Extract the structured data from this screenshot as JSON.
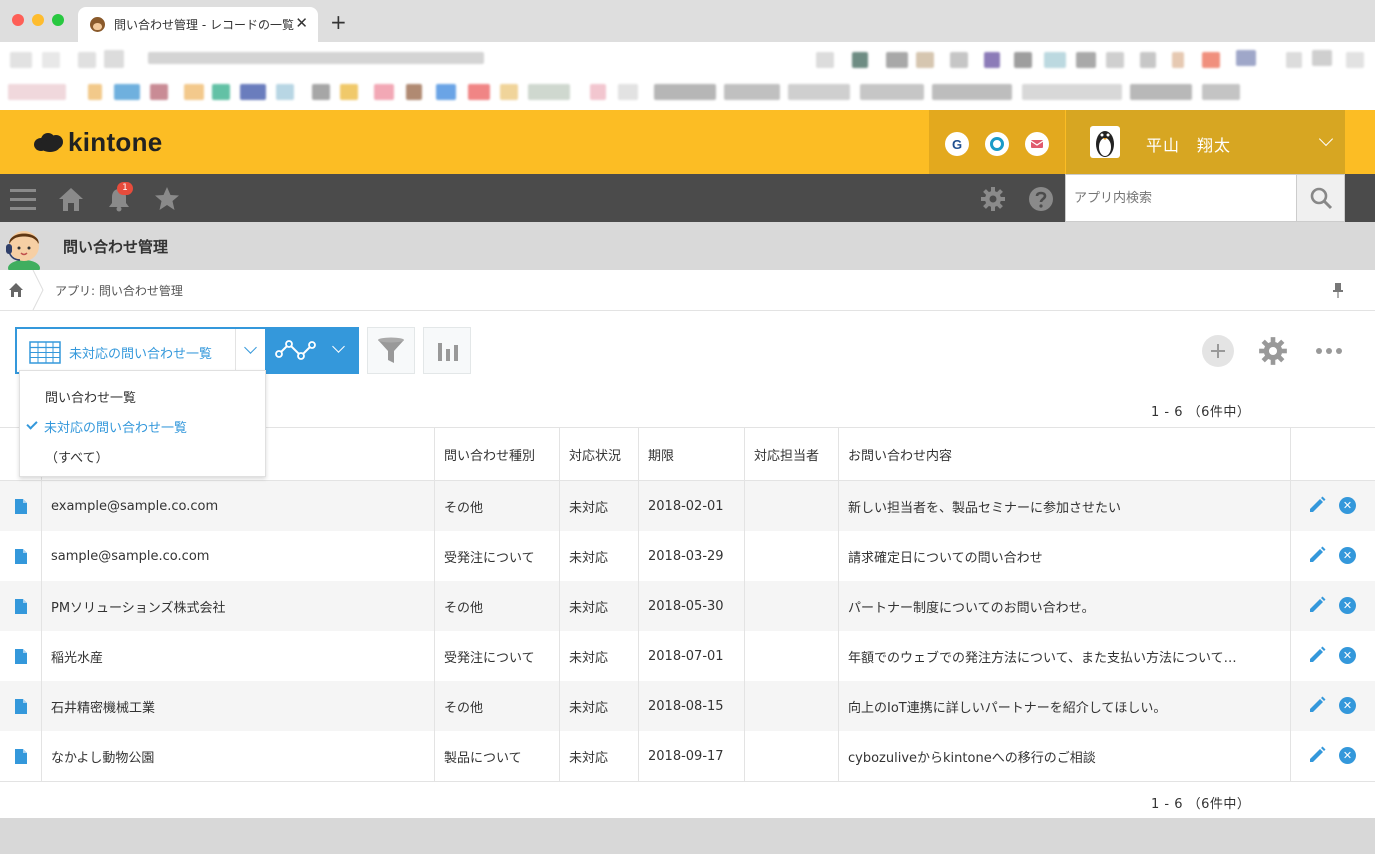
{
  "browser": {
    "tab_title": "問い合わせ管理 - レコードの一覧",
    "tab_close": "✕",
    "new_tab": "+"
  },
  "header": {
    "logo_text": "kintone",
    "user_name": "平山　翔太",
    "g_label": "G"
  },
  "nav": {
    "notification_count": "1",
    "search_placeholder": "アプリ内検索"
  },
  "app": {
    "title": "問い合わせ管理"
  },
  "breadcrumb": {
    "label": "アプリ: 問い合わせ管理"
  },
  "view_selector": {
    "selected": "未対応の問い合わせ一覧",
    "options": [
      {
        "label": "問い合わせ一覧",
        "checked": false
      },
      {
        "label": "未対応の問い合わせ一覧",
        "checked": true
      },
      {
        "label": "（すべて）",
        "checked": false
      }
    ]
  },
  "pager": {
    "top": "1 - 6 （6件中）",
    "bottom": "1 - 6 （6件中）"
  },
  "table": {
    "columns": [
      "",
      "",
      "問い合わせ種別",
      "対応状況",
      "期限",
      "対応担当者",
      "お問い合わせ内容",
      ""
    ],
    "rows": [
      {
        "company": "example@sample.co.com",
        "type": "その他",
        "status": "未対応",
        "due": "2018-02-01",
        "assignee": "",
        "content": "新しい担当者を、製品セミナーに参加させたい"
      },
      {
        "company": "sample@sample.co.com",
        "type": "受発注について",
        "status": "未対応",
        "due": "2018-03-29",
        "assignee": "",
        "content": "請求確定日についての問い合わせ"
      },
      {
        "company": "PMソリューションズ株式会社",
        "type": "その他",
        "status": "未対応",
        "due": "2018-05-30",
        "assignee": "",
        "content": "パートナー制度についてのお問い合わせ。"
      },
      {
        "company": "稲光水産",
        "type": "受発注について",
        "status": "未対応",
        "due": "2018-07-01",
        "assignee": "",
        "content": "年額でのウェブでの発注方法について、また支払い方法について…"
      },
      {
        "company": "石井精密機械工業",
        "type": "その他",
        "status": "未対応",
        "due": "2018-08-15",
        "assignee": "",
        "content": "向上のIoT連携に詳しいパートナーを紹介してほしい。"
      },
      {
        "company": "なかよし動物公園",
        "type": "製品について",
        "status": "未対応",
        "due": "2018-09-17",
        "assignee": "",
        "content": "cybozuliveからkintoneへの移行のご相談"
      }
    ]
  },
  "colors": {
    "header_yellow": "#fcbd24",
    "nav_dark": "#4b4b4b",
    "accent_blue": "#3498db"
  },
  "icons": [
    "home-icon",
    "bell-icon",
    "star-icon",
    "gear-icon",
    "help-icon",
    "search-icon",
    "graph-icon",
    "filter-icon",
    "bar-chart-icon",
    "plus-icon",
    "more-icon",
    "document-icon",
    "pencil-icon",
    "delete-icon",
    "pin-icon",
    "menu-icon"
  ]
}
